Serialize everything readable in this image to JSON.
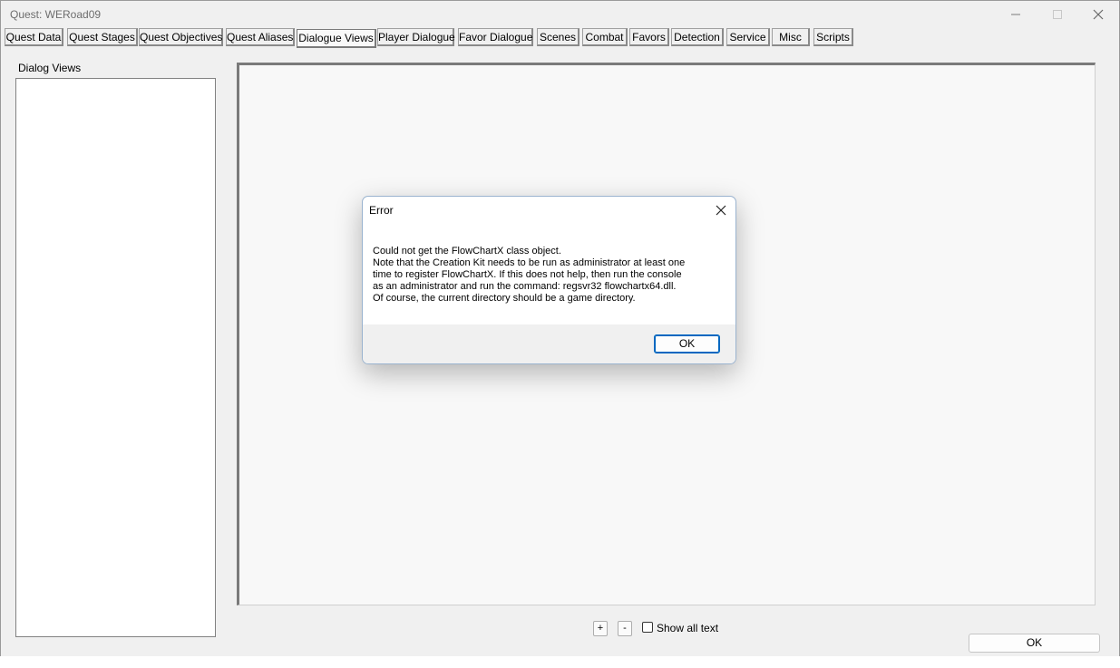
{
  "window": {
    "title": "Quest: WERoad09"
  },
  "tabs": [
    {
      "label": "Quest Data"
    },
    {
      "label": "Quest Stages"
    },
    {
      "label": "Quest Objectives"
    },
    {
      "label": "Quest Aliases"
    },
    {
      "label": "Dialogue Views"
    },
    {
      "label": "Player Dialogue"
    },
    {
      "label": "Favor Dialogue"
    },
    {
      "label": "Scenes"
    },
    {
      "label": "Combat"
    },
    {
      "label": "Favors"
    },
    {
      "label": "Detection"
    },
    {
      "label": "Service"
    },
    {
      "label": "Misc"
    },
    {
      "label": "Scripts"
    }
  ],
  "active_tab": "Dialogue Views",
  "panel": {
    "dialog_views_label": "Dialog Views",
    "zoom_in_label": "+",
    "zoom_out_label": "-",
    "show_all_text_label": "Show all text",
    "show_all_text_checked": false,
    "ok_label": "OK"
  },
  "error_dialog": {
    "title": "Error",
    "message": "Could not get the FlowChartX class object.\nNote that the Creation Kit needs to be run as administrator at least one\ntime to register FlowChartX. If this does not help, then run the console\nas an administrator and run the command: regsvr32 flowchartx64.dll.\nOf course, the current directory should be a game directory.",
    "ok_label": "OK"
  }
}
